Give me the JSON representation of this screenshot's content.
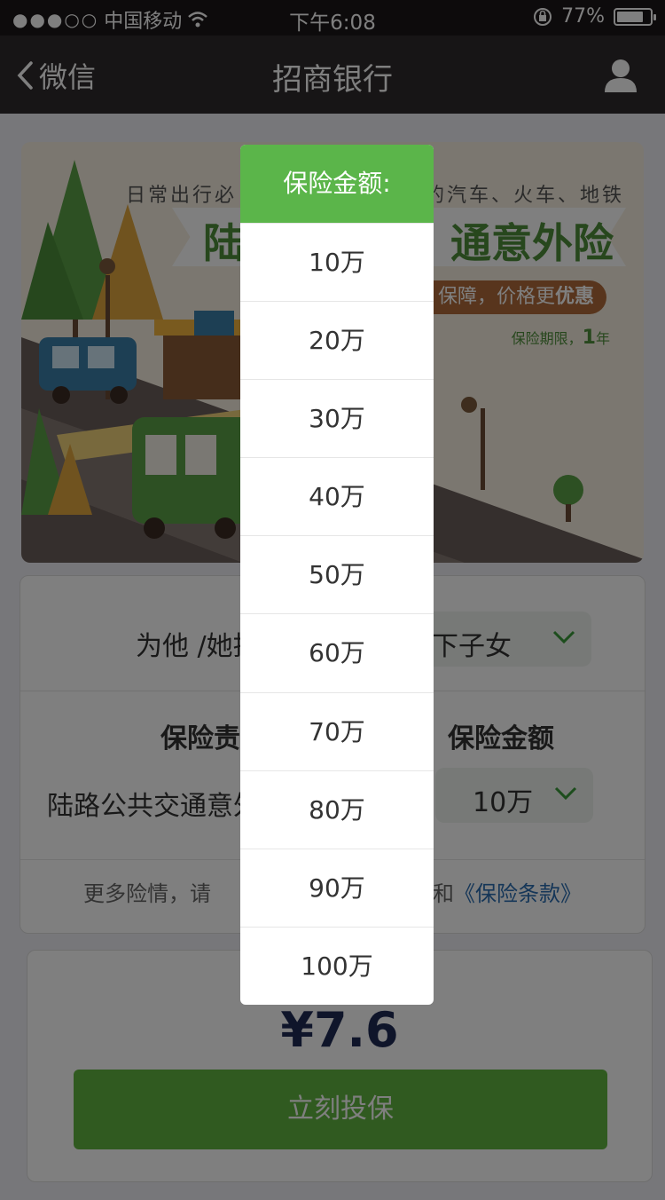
{
  "status_bar": {
    "signal": "●●●○○",
    "carrier": "中国移动",
    "time": "下午6:08",
    "battery_text": "77%",
    "battery_level": 0.77
  },
  "nav": {
    "back_label": "微信",
    "title": "招商银行"
  },
  "banner": {
    "tagline_left": "日常出行必",
    "tagline_right": "的汽车、火车、地铁",
    "headline_left": "陆",
    "headline_right": "通意外险",
    "pill_text_a": "保障，价格更",
    "pill_text_b": "优惠",
    "period_label": "保险期限，",
    "period_value": "1",
    "period_unit": "年"
  },
  "form": {
    "insured_label": "为他 /她投",
    "insured_value": "以下子女",
    "col_left_header": "保险责",
    "col_right_header": "保险金额",
    "item_name": "陆路公共交通意外",
    "amount_value": "10万",
    "note_prefix": "更多险情，请",
    "note_mid": "和",
    "note_link": "《保险条款》"
  },
  "pay": {
    "price": "¥7.6",
    "button_label": "立刻投保"
  },
  "picker": {
    "title": "保险金额:",
    "options": [
      "10万",
      "20万",
      "30万",
      "40万",
      "50万",
      "60万",
      "70万",
      "80万",
      "90万",
      "100万"
    ]
  },
  "colors": {
    "accent_green": "#5bb54a",
    "nav_bg": "#2e2b2c",
    "link_blue": "#2a6db0"
  }
}
